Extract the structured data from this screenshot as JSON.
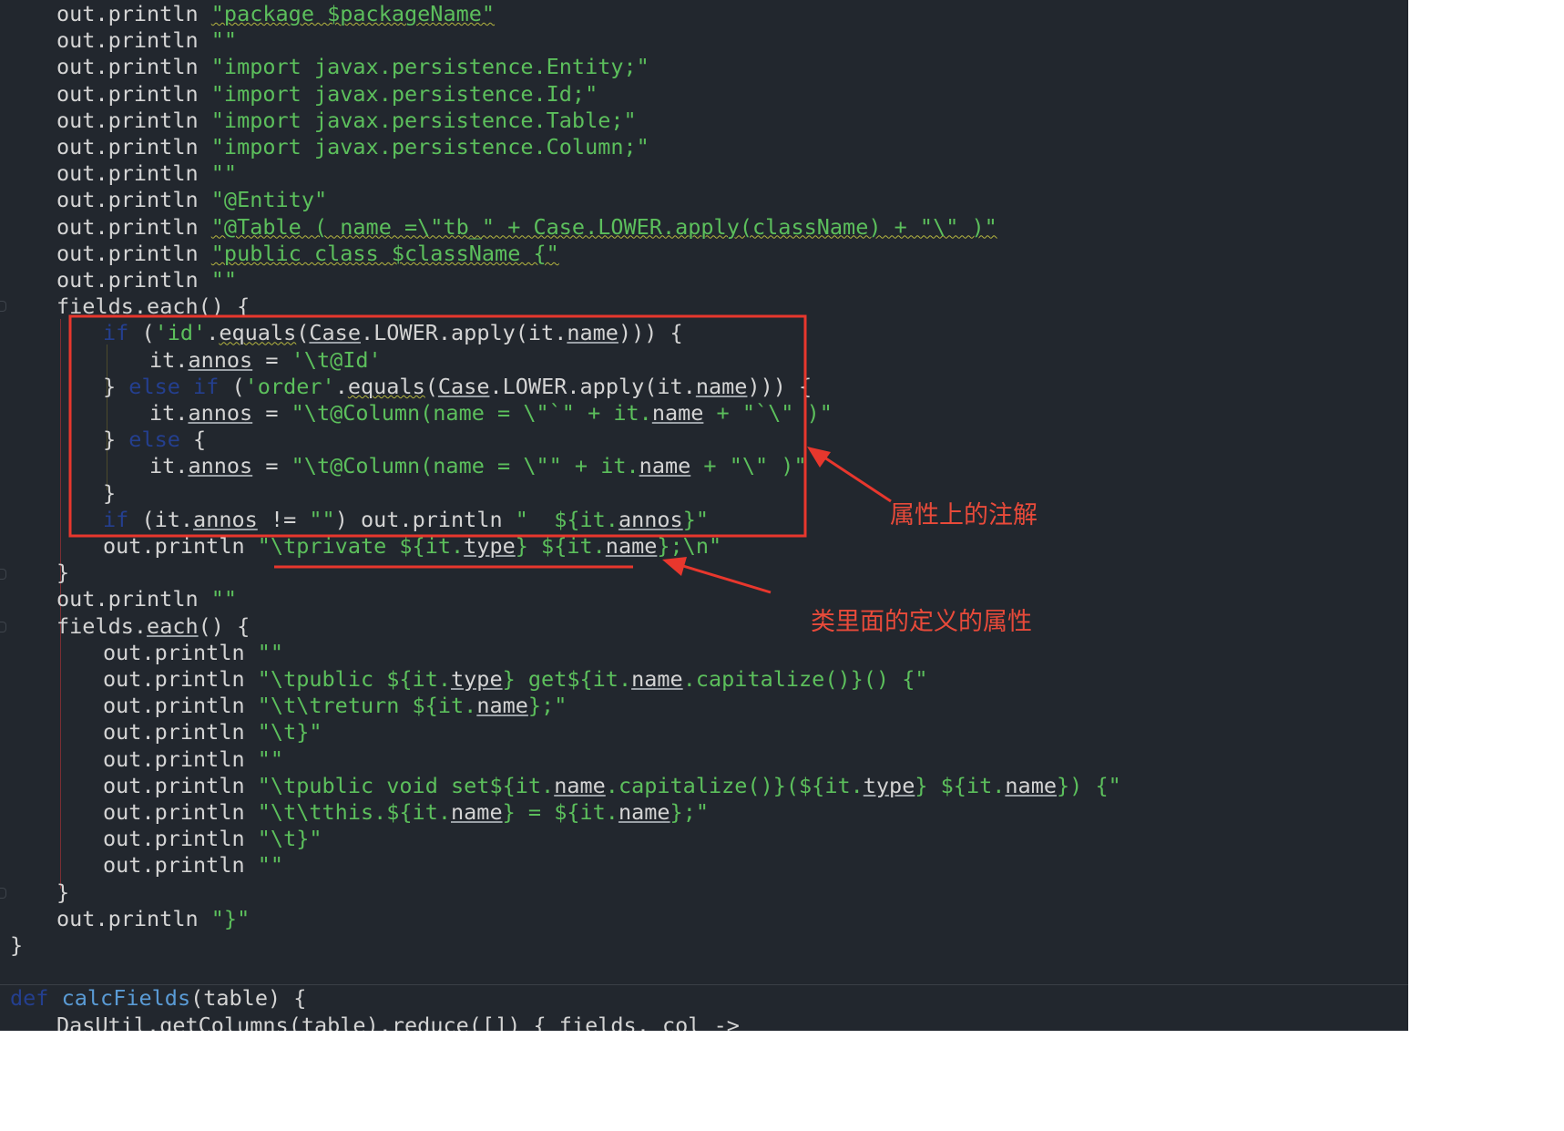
{
  "code_lines": [
    {
      "indent": 1,
      "tokens": [
        {
          "t": "out.println ",
          "c": "d"
        },
        {
          "t": "\"package $packageName\"",
          "c": "s",
          "wv": true
        }
      ]
    },
    {
      "indent": 1,
      "tokens": [
        {
          "t": "out.println ",
          "c": "d"
        },
        {
          "t": "\"\"",
          "c": "s"
        }
      ]
    },
    {
      "indent": 1,
      "tokens": [
        {
          "t": "out.println ",
          "c": "d"
        },
        {
          "t": "\"import javax.persistence.Entity;\"",
          "c": "s"
        }
      ]
    },
    {
      "indent": 1,
      "tokens": [
        {
          "t": "out.println ",
          "c": "d"
        },
        {
          "t": "\"import javax.persistence.Id;\"",
          "c": "s"
        }
      ]
    },
    {
      "indent": 1,
      "tokens": [
        {
          "t": "out.println ",
          "c": "d"
        },
        {
          "t": "\"import javax.persistence.Table;\"",
          "c": "s"
        }
      ]
    },
    {
      "indent": 1,
      "tokens": [
        {
          "t": "out.println ",
          "c": "d"
        },
        {
          "t": "\"import javax.persistence.Column;\"",
          "c": "s"
        }
      ]
    },
    {
      "indent": 1,
      "tokens": [
        {
          "t": "out.println ",
          "c": "d"
        },
        {
          "t": "\"\"",
          "c": "s"
        }
      ]
    },
    {
      "indent": 1,
      "tokens": [
        {
          "t": "out.println ",
          "c": "d"
        },
        {
          "t": "\"@Entity\"",
          "c": "s"
        }
      ]
    },
    {
      "indent": 1,
      "tokens": [
        {
          "t": "out.println ",
          "c": "d"
        },
        {
          "t": "\"@Table ( name =\\\"tb_\" + Case.LOWER.apply(className) + \"\\\" )\"",
          "c": "s",
          "wv": true
        }
      ]
    },
    {
      "indent": 1,
      "tokens": [
        {
          "t": "out.println ",
          "c": "d"
        },
        {
          "t": "\"public class $className {\"",
          "c": "s",
          "wv": true
        }
      ]
    },
    {
      "indent": 1,
      "tokens": [
        {
          "t": "out.println ",
          "c": "d"
        },
        {
          "t": "\"\"",
          "c": "s"
        }
      ]
    },
    {
      "indent": 1,
      "tokens": [
        {
          "t": "fields.",
          "c": "d"
        },
        {
          "t": "each",
          "c": "d",
          "ul": true
        },
        {
          "t": "() {",
          "c": "d"
        }
      ]
    },
    {
      "indent": 2,
      "tokens": [
        {
          "t": "if",
          "c": "k"
        },
        {
          "t": " (",
          "c": "d"
        },
        {
          "t": "'id'",
          "c": "s"
        },
        {
          "t": ".",
          "c": "d"
        },
        {
          "t": "equals",
          "c": "d",
          "wv": true
        },
        {
          "t": "(",
          "c": "d"
        },
        {
          "t": "Case",
          "c": "d",
          "ul": true
        },
        {
          "t": ".LOWER.apply(it.",
          "c": "d"
        },
        {
          "t": "name",
          "c": "d",
          "ul": true
        },
        {
          "t": "))) {",
          "c": "d"
        }
      ]
    },
    {
      "indent": 3,
      "tokens": [
        {
          "t": "it.",
          "c": "d"
        },
        {
          "t": "annos",
          "c": "d",
          "ul": true
        },
        {
          "t": " = ",
          "c": "d"
        },
        {
          "t": "'\\t@Id'",
          "c": "s"
        }
      ]
    },
    {
      "indent": 2,
      "tokens": [
        {
          "t": "} ",
          "c": "d"
        },
        {
          "t": "else if",
          "c": "k"
        },
        {
          "t": " (",
          "c": "d"
        },
        {
          "t": "'order'",
          "c": "s"
        },
        {
          "t": ".",
          "c": "d"
        },
        {
          "t": "equals",
          "c": "d",
          "wv": true
        },
        {
          "t": "(",
          "c": "d"
        },
        {
          "t": "Case",
          "c": "d",
          "ul": true
        },
        {
          "t": ".LOWER.apply(it.",
          "c": "d"
        },
        {
          "t": "name",
          "c": "d",
          "ul": true
        },
        {
          "t": "))) {",
          "c": "d"
        }
      ]
    },
    {
      "indent": 3,
      "tokens": [
        {
          "t": "it.",
          "c": "d"
        },
        {
          "t": "annos",
          "c": "d",
          "ul": true
        },
        {
          "t": " = ",
          "c": "d"
        },
        {
          "t": "\"\\t@Column(name = \\\"`\" + it.",
          "c": "s"
        },
        {
          "t": "name",
          "c": "d",
          "ul": true
        },
        {
          "t": " + \"`\\\" )\"",
          "c": "s"
        }
      ]
    },
    {
      "indent": 2,
      "tokens": [
        {
          "t": "} ",
          "c": "d"
        },
        {
          "t": "else",
          "c": "k"
        },
        {
          "t": " {",
          "c": "d"
        }
      ]
    },
    {
      "indent": 3,
      "tokens": [
        {
          "t": "it.",
          "c": "d"
        },
        {
          "t": "annos",
          "c": "d",
          "ul": true
        },
        {
          "t": " = ",
          "c": "d"
        },
        {
          "t": "\"\\t@Column(name = \\\"\" + it.",
          "c": "s"
        },
        {
          "t": "name",
          "c": "d",
          "ul": true
        },
        {
          "t": " + \"\\\" )\"",
          "c": "s"
        }
      ]
    },
    {
      "indent": 2,
      "tokens": [
        {
          "t": "}",
          "c": "d"
        }
      ]
    },
    {
      "indent": 2,
      "tokens": [
        {
          "t": "if",
          "c": "k"
        },
        {
          "t": " (it.",
          "c": "d"
        },
        {
          "t": "annos",
          "c": "d",
          "ul": true
        },
        {
          "t": " != ",
          "c": "d"
        },
        {
          "t": "\"\"",
          "c": "s"
        },
        {
          "t": ") out.println ",
          "c": "d"
        },
        {
          "t": "\"  ${it.",
          "c": "s"
        },
        {
          "t": "annos",
          "c": "d",
          "ul": true
        },
        {
          "t": "}\"",
          "c": "s"
        }
      ]
    },
    {
      "indent": 2,
      "tokens": [
        {
          "t": "out.println ",
          "c": "d"
        },
        {
          "t": "\"\\tprivate ${it.",
          "c": "s"
        },
        {
          "t": "type",
          "c": "d",
          "ul": true
        },
        {
          "t": "} ${it.",
          "c": "s"
        },
        {
          "t": "name",
          "c": "d",
          "ul": true
        },
        {
          "t": "};\\n\"",
          "c": "s"
        }
      ]
    },
    {
      "indent": 1,
      "tokens": [
        {
          "t": "}",
          "c": "d"
        }
      ]
    },
    {
      "indent": 1,
      "tokens": [
        {
          "t": "out.println ",
          "c": "d"
        },
        {
          "t": "\"\"",
          "c": "s"
        }
      ]
    },
    {
      "indent": 1,
      "tokens": [
        {
          "t": "fields.",
          "c": "d"
        },
        {
          "t": "each",
          "c": "d",
          "ul": true
        },
        {
          "t": "() {",
          "c": "d"
        }
      ]
    },
    {
      "indent": 2,
      "tokens": [
        {
          "t": "out.println ",
          "c": "d"
        },
        {
          "t": "\"\"",
          "c": "s"
        }
      ]
    },
    {
      "indent": 2,
      "tokens": [
        {
          "t": "out.println ",
          "c": "d"
        },
        {
          "t": "\"\\tpublic ${it.",
          "c": "s"
        },
        {
          "t": "type",
          "c": "d",
          "ul": true
        },
        {
          "t": "} get${it.",
          "c": "s"
        },
        {
          "t": "name",
          "c": "d",
          "ul": true
        },
        {
          "t": ".capitalize()}() {\"",
          "c": "s"
        }
      ]
    },
    {
      "indent": 2,
      "tokens": [
        {
          "t": "out.println ",
          "c": "d"
        },
        {
          "t": "\"\\t\\treturn ${it.",
          "c": "s"
        },
        {
          "t": "name",
          "c": "d",
          "ul": true
        },
        {
          "t": "};\"",
          "c": "s"
        }
      ]
    },
    {
      "indent": 2,
      "tokens": [
        {
          "t": "out.println ",
          "c": "d"
        },
        {
          "t": "\"\\t}\"",
          "c": "s"
        }
      ]
    },
    {
      "indent": 2,
      "tokens": [
        {
          "t": "out.println ",
          "c": "d"
        },
        {
          "t": "\"\"",
          "c": "s"
        }
      ]
    },
    {
      "indent": 2,
      "tokens": [
        {
          "t": "out.println ",
          "c": "d"
        },
        {
          "t": "\"\\tpublic void set${it.",
          "c": "s"
        },
        {
          "t": "name",
          "c": "d",
          "ul": true
        },
        {
          "t": ".capitalize()}(${it.",
          "c": "s"
        },
        {
          "t": "type",
          "c": "d",
          "ul": true
        },
        {
          "t": "} ${it.",
          "c": "s"
        },
        {
          "t": "name",
          "c": "d",
          "ul": true
        },
        {
          "t": "}) {\"",
          "c": "s"
        }
      ]
    },
    {
      "indent": 2,
      "tokens": [
        {
          "t": "out.println ",
          "c": "d"
        },
        {
          "t": "\"\\t\\tthis.${it.",
          "c": "s"
        },
        {
          "t": "name",
          "c": "d",
          "ul": true
        },
        {
          "t": "} = ${it.",
          "c": "s"
        },
        {
          "t": "name",
          "c": "d",
          "ul": true
        },
        {
          "t": "};\"",
          "c": "s"
        }
      ]
    },
    {
      "indent": 2,
      "tokens": [
        {
          "t": "out.println ",
          "c": "d"
        },
        {
          "t": "\"\\t}\"",
          "c": "s"
        }
      ]
    },
    {
      "indent": 2,
      "tokens": [
        {
          "t": "out.println ",
          "c": "d"
        },
        {
          "t": "\"\"",
          "c": "s"
        }
      ]
    },
    {
      "indent": 1,
      "tokens": [
        {
          "t": "}",
          "c": "d"
        }
      ]
    },
    {
      "indent": 1,
      "tokens": [
        {
          "t": "out.println ",
          "c": "d"
        },
        {
          "t": "\"}\"",
          "c": "s"
        }
      ]
    },
    {
      "indent": 0,
      "tokens": [
        {
          "t": "}",
          "c": "d"
        }
      ]
    },
    {
      "indent": 0,
      "tokens": []
    },
    {
      "indent": 0,
      "tokens": [
        {
          "t": "def",
          "c": "k"
        },
        {
          "t": " ",
          "c": "d"
        },
        {
          "t": "calcFields",
          "c": "f"
        },
        {
          "t": "(table) {",
          "c": "d"
        }
      ]
    },
    {
      "indent": 1,
      "tokens": [
        {
          "t": "DasUtil",
          "c": "d",
          "ul": true
        },
        {
          "t": ".",
          "c": "d"
        },
        {
          "t": "getColumns",
          "c": "d",
          "ul": true
        },
        {
          "t": "(table).",
          "c": "d"
        },
        {
          "t": "reduce",
          "c": "d",
          "ul": true
        },
        {
          "t": "([]) { fields, col ->",
          "c": "d"
        }
      ]
    }
  ],
  "annotations": {
    "field_annotations_label": "属性上的注解",
    "class_fields_label": "类里面的定义的属性"
  },
  "colors": {
    "editor_bg": "#22272e",
    "default_text": "#d4d4d4",
    "string": "#5cbf5c",
    "keyword": "#243f8f",
    "function_name": "#5a9bd5",
    "annotation_red": "#e8372d"
  }
}
